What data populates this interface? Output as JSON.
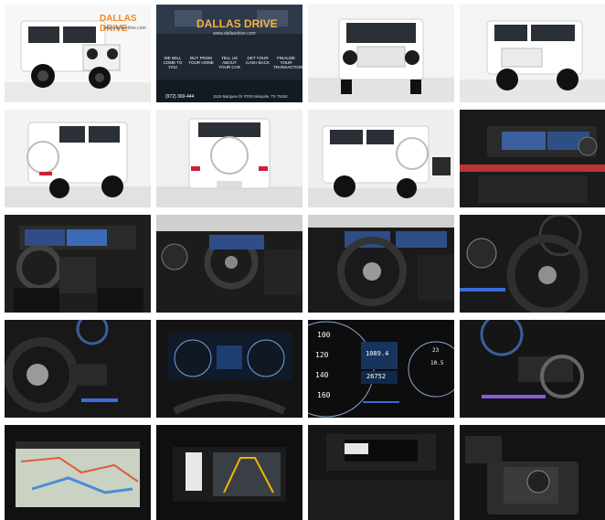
{
  "gallery": {
    "tile1": {
      "brand": "DALLAS DRIVE",
      "subtitle": "www.dallasdrive.com"
    },
    "tile2": {
      "brand": "DALLAS DRIVE",
      "subtitle": "www.dallasdrive.com",
      "features": [
        "WE WILL COME TO YOU",
        "BUY FROM YOUR HOME",
        "TELL US ABOUT YOUR CAR",
        "GET YOUR CASH BACK",
        "FINALIZE YOUR TRANSACTION"
      ],
      "phone": "(972) 369-444",
      "address": "1515 Marquee Dr #700 Mesquite, TX 75150"
    },
    "tile15": {
      "speed_ticks": [
        "100",
        "120",
        "140",
        "160"
      ],
      "odo1": "1089.4",
      "odo2": "26752",
      "right_values": [
        "23",
        "10.5"
      ]
    }
  },
  "colors": {
    "accent_blue": "#3a6bd8",
    "brand_red": "#d6402a",
    "brand_orange": "#f08a24",
    "vehicle_white": "#f3f3f3",
    "interior_black": "#1a1a1a"
  }
}
